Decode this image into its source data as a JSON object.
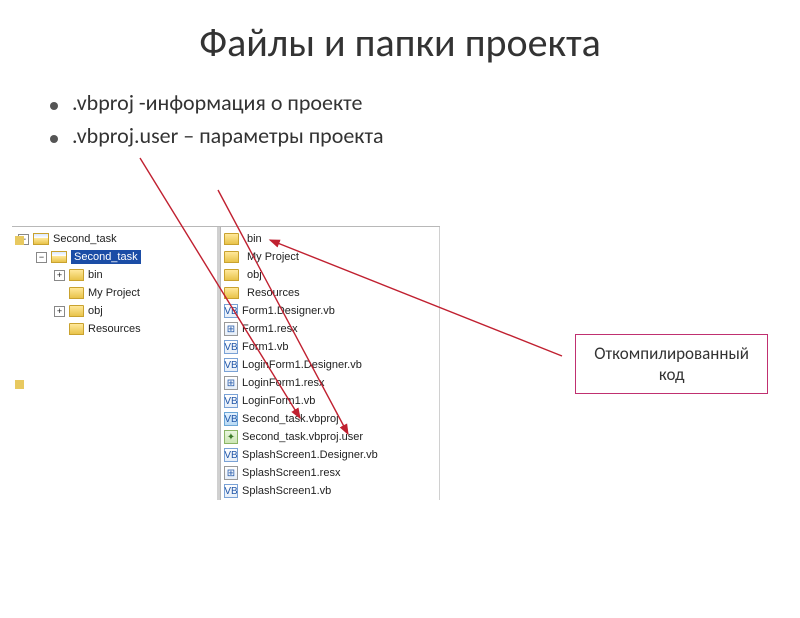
{
  "slide": {
    "title": "Файлы и папки проекта"
  },
  "bullets": {
    "b1": ".vbproj  -информация о проекте",
    "b2": ".vbproj.user – параметры проекта"
  },
  "tree": {
    "root": "Second_task",
    "selected": "Second_task",
    "children": {
      "c0": "bin",
      "c1": "My Project",
      "c2": "obj",
      "c3": "Resources"
    }
  },
  "list": {
    "i0": "bin",
    "i1": "My Project",
    "i2": "obj",
    "i3": "Resources",
    "i4": "Form1.Designer.vb",
    "i5": "Form1.resx",
    "i6": "Form1.vb",
    "i7": "LoginForm1.Designer.vb",
    "i8": "LoginForm1.resx",
    "i9": "LoginForm1.vb",
    "i10": "Second_task.vbproj",
    "i11": "Second_task.vbproj.user",
    "i12": "SplashScreen1.Designer.vb",
    "i13": "SplashScreen1.resx",
    "i14": "SplashScreen1.vb"
  },
  "callout": {
    "line1": "Откомпилированный",
    "line2": "код"
  },
  "glyphs": {
    "minus": "−",
    "plus": "+"
  }
}
